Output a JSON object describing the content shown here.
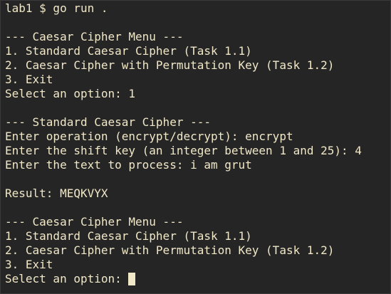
{
  "terminal": {
    "lines": [
      "lab1 $ go run .",
      "",
      "--- Caesar Cipher Menu ---",
      "1. Standard Caesar Cipher (Task 1.1)",
      "2. Caesar Cipher with Permutation Key (Task 1.2)",
      "3. Exit",
      "Select an option: 1",
      "",
      "--- Standard Caesar Cipher ---",
      "Enter operation (encrypt/decrypt): encrypt",
      "Enter the shift key (an integer between 1 and 25): 4",
      "Enter the text to process: i am grut",
      "",
      "Result: MEQKVYX",
      "",
      "--- Caesar Cipher Menu ---",
      "1. Standard Caesar Cipher (Task 1.1)",
      "2. Caesar Cipher with Permutation Key (Task 1.2)",
      "3. Exit"
    ],
    "prompt": "Select an option: ",
    "colors": {
      "background": "#252525",
      "text": "#f1e8c8"
    }
  }
}
